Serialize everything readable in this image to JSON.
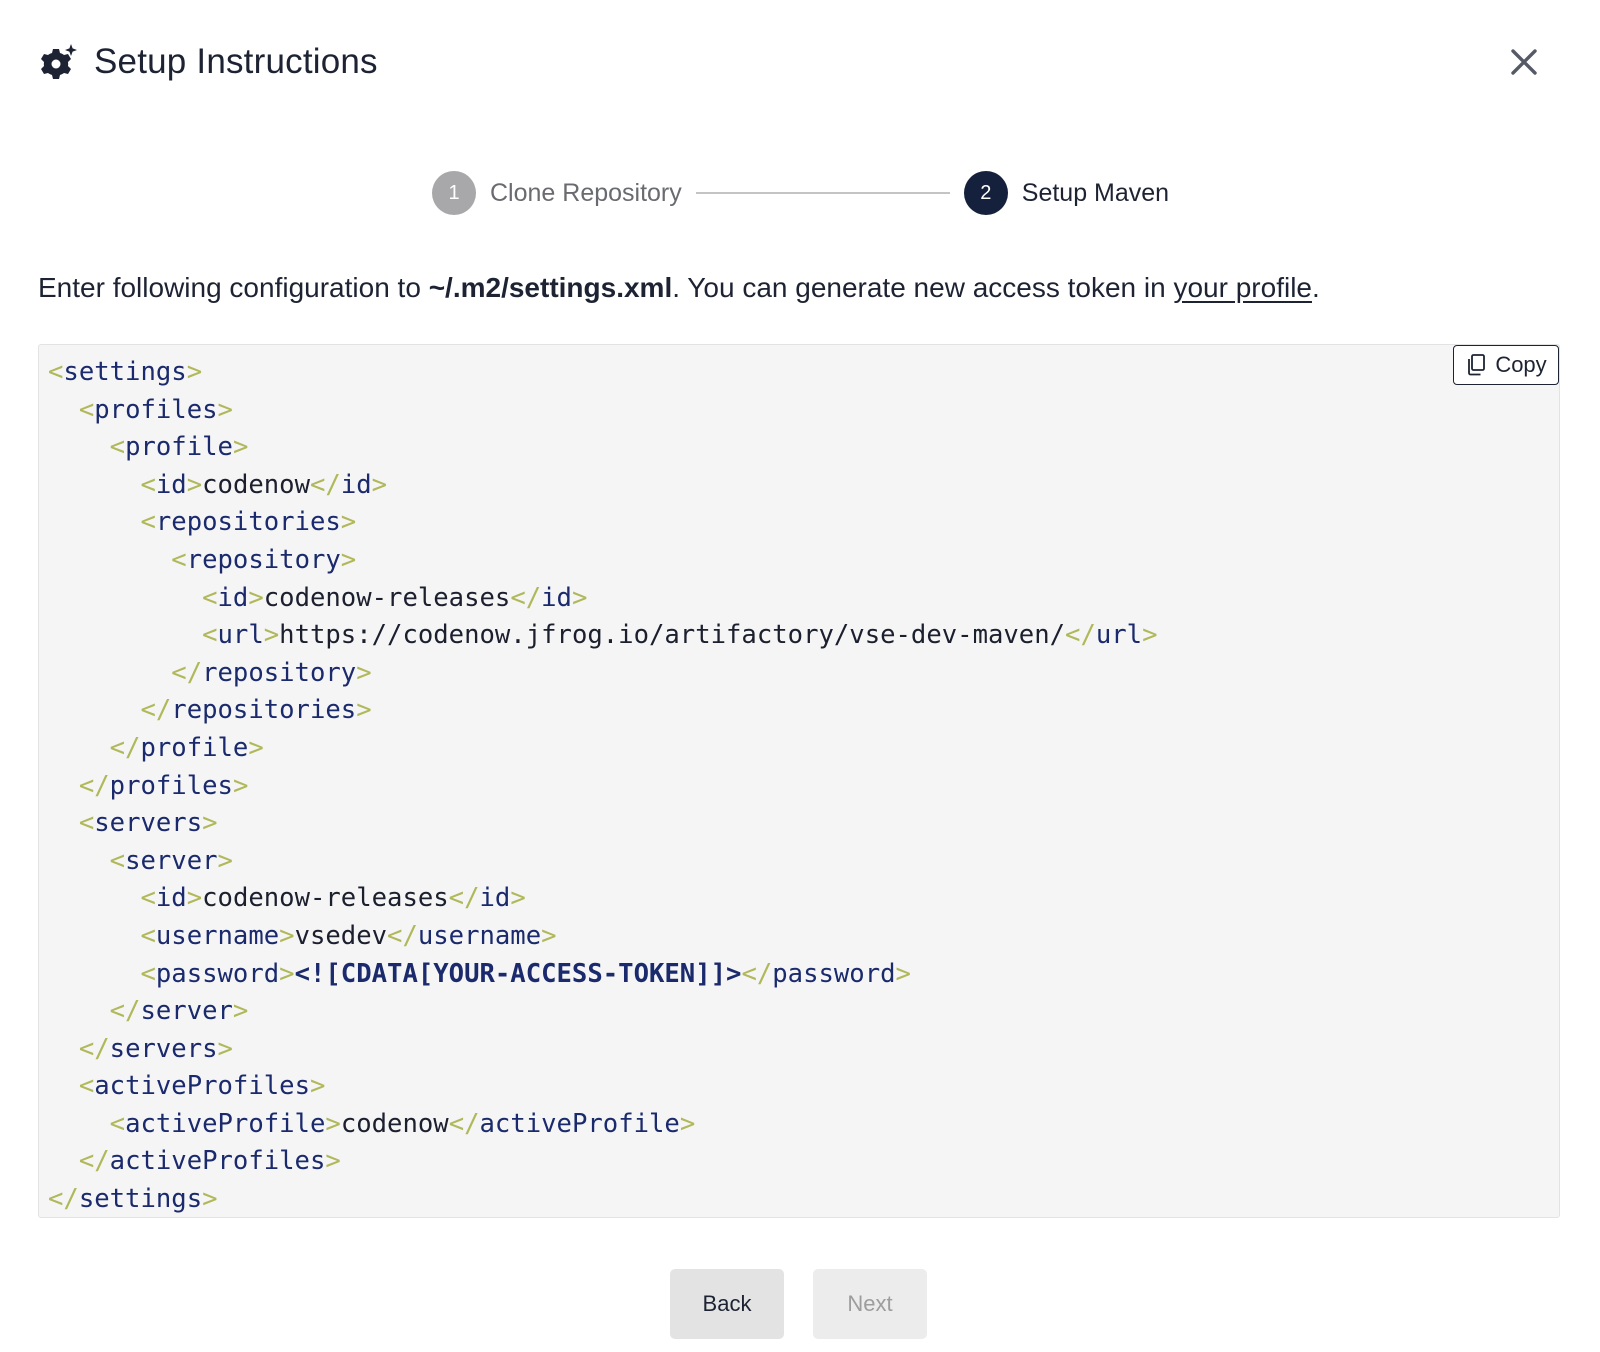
{
  "header": {
    "title": "Setup Instructions",
    "icon": "gear-sparkle-icon",
    "close_icon": "close-icon"
  },
  "stepper": {
    "steps": [
      {
        "number": "1",
        "label": "Clone Repository",
        "state": "done"
      },
      {
        "number": "2",
        "label": "Setup Maven",
        "state": "active"
      }
    ]
  },
  "instruction": {
    "prefix": "Enter following configuration to ",
    "path": "~/.m2/settings.xml",
    "middle": ". You can generate new access token in ",
    "link": "your profile",
    "suffix": "."
  },
  "code": {
    "copy_label": "Copy",
    "copy_icon": "copy-icon",
    "colors": {
      "angle_brackets": "#b0b85a",
      "tag_names": "#1a2a6c",
      "text": "#1b1f2e",
      "background": "#f5f5f5"
    },
    "lines": [
      {
        "indent": 0,
        "tokens": [
          [
            "ab",
            "<"
          ],
          [
            "tg",
            "settings"
          ],
          [
            "ab",
            ">"
          ]
        ]
      },
      {
        "indent": 1,
        "tokens": [
          [
            "ab",
            "<"
          ],
          [
            "tg",
            "profiles"
          ],
          [
            "ab",
            ">"
          ]
        ]
      },
      {
        "indent": 2,
        "tokens": [
          [
            "ab",
            "<"
          ],
          [
            "tg",
            "profile"
          ],
          [
            "ab",
            ">"
          ]
        ]
      },
      {
        "indent": 3,
        "tokens": [
          [
            "ab",
            "<"
          ],
          [
            "tg",
            "id"
          ],
          [
            "ab",
            ">"
          ],
          [
            "tx",
            "codenow"
          ],
          [
            "ab",
            "</"
          ],
          [
            "tg",
            "id"
          ],
          [
            "ab",
            ">"
          ]
        ]
      },
      {
        "indent": 3,
        "tokens": [
          [
            "ab",
            "<"
          ],
          [
            "tg",
            "repositories"
          ],
          [
            "ab",
            ">"
          ]
        ]
      },
      {
        "indent": 4,
        "tokens": [
          [
            "ab",
            "<"
          ],
          [
            "tg",
            "repository"
          ],
          [
            "ab",
            ">"
          ]
        ]
      },
      {
        "indent": 5,
        "tokens": [
          [
            "ab",
            "<"
          ],
          [
            "tg",
            "id"
          ],
          [
            "ab",
            ">"
          ],
          [
            "tx",
            "codenow-releases"
          ],
          [
            "ab",
            "</"
          ],
          [
            "tg",
            "id"
          ],
          [
            "ab",
            ">"
          ]
        ]
      },
      {
        "indent": 5,
        "tokens": [
          [
            "ab",
            "<"
          ],
          [
            "tg",
            "url"
          ],
          [
            "ab",
            ">"
          ],
          [
            "tx",
            "https://codenow.jfrog.io/artifactory/vse-dev-maven/"
          ],
          [
            "ab",
            "</"
          ],
          [
            "tg",
            "url"
          ],
          [
            "ab",
            ">"
          ]
        ]
      },
      {
        "indent": 4,
        "tokens": [
          [
            "ab",
            "</"
          ],
          [
            "tg",
            "repository"
          ],
          [
            "ab",
            ">"
          ]
        ]
      },
      {
        "indent": 3,
        "tokens": [
          [
            "ab",
            "</"
          ],
          [
            "tg",
            "repositories"
          ],
          [
            "ab",
            ">"
          ]
        ]
      },
      {
        "indent": 2,
        "tokens": [
          [
            "ab",
            "</"
          ],
          [
            "tg",
            "profile"
          ],
          [
            "ab",
            ">"
          ]
        ]
      },
      {
        "indent": 1,
        "tokens": [
          [
            "ab",
            "</"
          ],
          [
            "tg",
            "profiles"
          ],
          [
            "ab",
            ">"
          ]
        ]
      },
      {
        "indent": 1,
        "tokens": [
          [
            "ab",
            "<"
          ],
          [
            "tg",
            "servers"
          ],
          [
            "ab",
            ">"
          ]
        ]
      },
      {
        "indent": 2,
        "tokens": [
          [
            "ab",
            "<"
          ],
          [
            "tg",
            "server"
          ],
          [
            "ab",
            ">"
          ]
        ]
      },
      {
        "indent": 3,
        "tokens": [
          [
            "ab",
            "<"
          ],
          [
            "tg",
            "id"
          ],
          [
            "ab",
            ">"
          ],
          [
            "tx",
            "codenow-releases"
          ],
          [
            "ab",
            "</"
          ],
          [
            "tg",
            "id"
          ],
          [
            "ab",
            ">"
          ]
        ]
      },
      {
        "indent": 3,
        "tokens": [
          [
            "ab",
            "<"
          ],
          [
            "tg",
            "username"
          ],
          [
            "ab",
            ">"
          ],
          [
            "tx",
            "vsedev"
          ],
          [
            "ab",
            "</"
          ],
          [
            "tg",
            "username"
          ],
          [
            "ab",
            ">"
          ]
        ]
      },
      {
        "indent": 3,
        "tokens": [
          [
            "ab",
            "<"
          ],
          [
            "tg",
            "password"
          ],
          [
            "ab",
            ">"
          ],
          [
            "cd",
            "<![CDATA[YOUR-ACCESS-TOKEN]]>"
          ],
          [
            "ab",
            "</"
          ],
          [
            "tg",
            "password"
          ],
          [
            "ab",
            ">"
          ]
        ]
      },
      {
        "indent": 2,
        "tokens": [
          [
            "ab",
            "</"
          ],
          [
            "tg",
            "server"
          ],
          [
            "ab",
            ">"
          ]
        ]
      },
      {
        "indent": 1,
        "tokens": [
          [
            "ab",
            "</"
          ],
          [
            "tg",
            "servers"
          ],
          [
            "ab",
            ">"
          ]
        ]
      },
      {
        "indent": 1,
        "tokens": [
          [
            "ab",
            "<"
          ],
          [
            "tg",
            "activeProfiles"
          ],
          [
            "ab",
            ">"
          ]
        ]
      },
      {
        "indent": 2,
        "tokens": [
          [
            "ab",
            "<"
          ],
          [
            "tg",
            "activeProfile"
          ],
          [
            "ab",
            ">"
          ],
          [
            "tx",
            "codenow"
          ],
          [
            "ab",
            "</"
          ],
          [
            "tg",
            "activeProfile"
          ],
          [
            "ab",
            ">"
          ]
        ]
      },
      {
        "indent": 1,
        "tokens": [
          [
            "ab",
            "</"
          ],
          [
            "tg",
            "activeProfiles"
          ],
          [
            "ab",
            ">"
          ]
        ]
      },
      {
        "indent": 0,
        "tokens": [
          [
            "ab",
            "</"
          ],
          [
            "tg",
            "settings"
          ],
          [
            "ab",
            ">"
          ]
        ]
      }
    ]
  },
  "footer": {
    "back_label": "Back",
    "next_label": "Next"
  }
}
